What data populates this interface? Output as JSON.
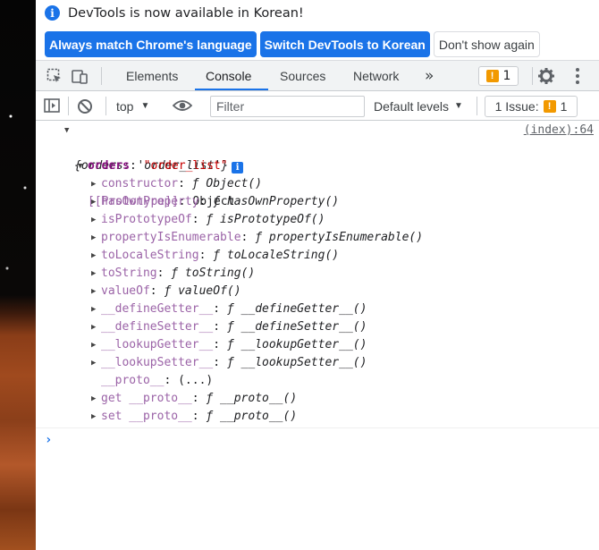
{
  "infobar": {
    "message": "DevTools is now available in Korean!",
    "buttons": {
      "always_match": "Always match Chrome's language",
      "switch": "Switch DevTools to Korean",
      "dont_show": "Don't show again"
    }
  },
  "tabs": {
    "elements": "Elements",
    "console": "Console",
    "sources": "Sources",
    "network": "Network",
    "more": "»",
    "warnings_count": "1"
  },
  "toolbar": {
    "context": "top",
    "filter_placeholder": "Filter",
    "levels": "Default levels",
    "issues_label": "1 Issue:",
    "issues_count": "1"
  },
  "console": {
    "summary": "{orders: 'order_list'}",
    "source": "(index):64",
    "orders_key": "orders",
    "orders_value": "\"order_list\"",
    "prototype_key": "[[Prototype]]",
    "prototype_value": "Object",
    "members": [
      {
        "key": "constructor",
        "value": "ƒ Object()"
      },
      {
        "key": "hasOwnProperty",
        "value": "ƒ hasOwnProperty()"
      },
      {
        "key": "isPrototypeOf",
        "value": "ƒ isPrototypeOf()"
      },
      {
        "key": "propertyIsEnumerable",
        "value": "ƒ propertyIsEnumerable()"
      },
      {
        "key": "toLocaleString",
        "value": "ƒ toLocaleString()"
      },
      {
        "key": "toString",
        "value": "ƒ toString()"
      },
      {
        "key": "valueOf",
        "value": "ƒ valueOf()"
      },
      {
        "key": "__defineGetter__",
        "value": "ƒ __defineGetter__()"
      },
      {
        "key": "__defineSetter__",
        "value": "ƒ __defineSetter__()"
      },
      {
        "key": "__lookupGetter__",
        "value": "ƒ __lookupGetter__()"
      },
      {
        "key": "__lookupSetter__",
        "value": "ƒ __lookupSetter__()"
      },
      {
        "key": "__proto__",
        "value": "(...)"
      },
      {
        "key": "get __proto__",
        "value": "ƒ __proto__()"
      },
      {
        "key": "set __proto__",
        "value": "ƒ __proto__()"
      }
    ],
    "prompt": "›"
  },
  "colors": {
    "accent": "#1a73e8",
    "warning": "#f29900",
    "string": "#c80000",
    "property": "#881280"
  }
}
